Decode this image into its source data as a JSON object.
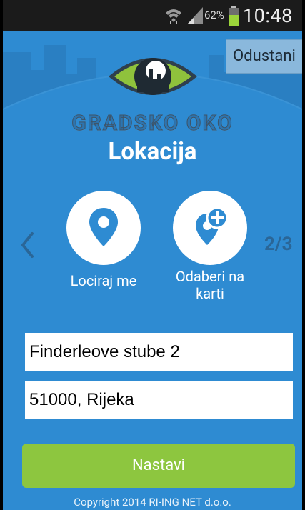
{
  "status_bar": {
    "battery_percent": "62%",
    "time": "10:48",
    "icons": [
      "wifi-icon",
      "signal-icon",
      "battery-icon"
    ]
  },
  "header": {
    "cancel_label": "Odustani",
    "brand_name": "GRADSKO OKO",
    "title": "Lokacija"
  },
  "options": {
    "locate_me_label": "Lociraj me",
    "pick_on_map_label": "Odaberi na karti",
    "locate_icon": "map-pin-icon",
    "pick_icon": "map-pin-plus-icon"
  },
  "step_indicator": "2/3",
  "address": {
    "street": "Finderleove stube 2",
    "city": "51000, Rijeka"
  },
  "next_label": "Nastavi",
  "copyright": "Copyright 2014 RI-ING NET d.o.o.",
  "colors": {
    "background": "#2e8bd2",
    "button_green": "#8dc63f",
    "logo_green": "#8fc23c"
  }
}
